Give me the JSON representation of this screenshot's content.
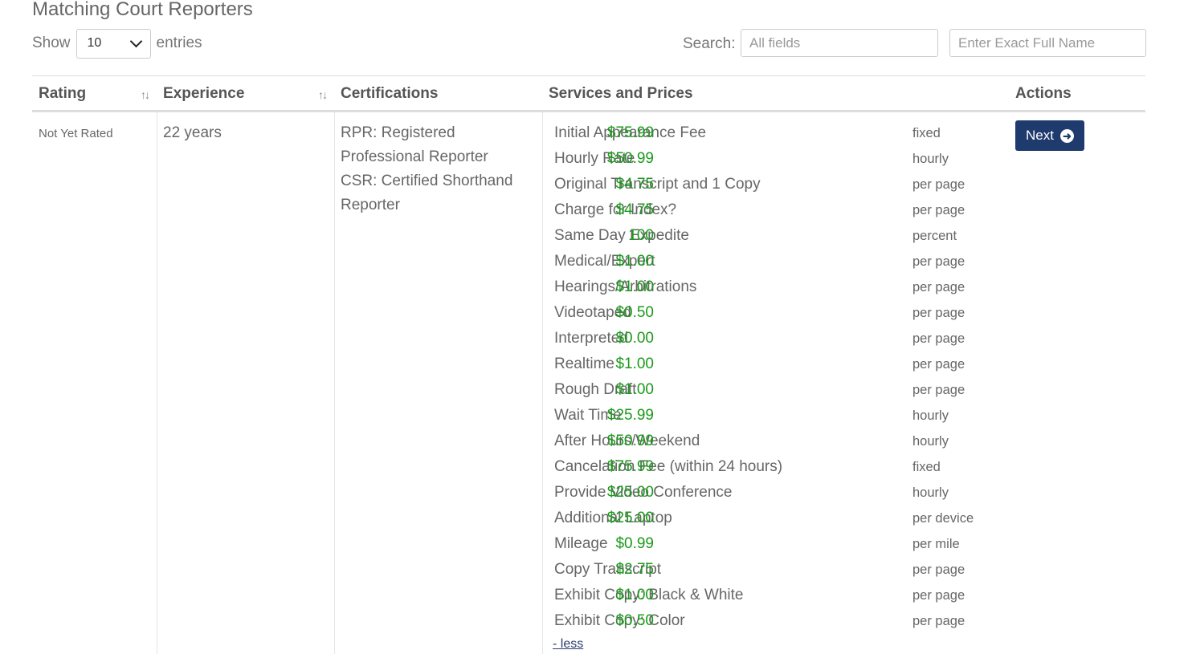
{
  "page": {
    "title": "Matching Court Reporters"
  },
  "length": {
    "show_label": "Show",
    "value": "10",
    "entries_label": "entries"
  },
  "search": {
    "label": "Search:",
    "all_fields_placeholder": "All fields",
    "exact_name_placeholder": "Enter Exact Full Name"
  },
  "table": {
    "headers": {
      "rating": "Rating",
      "experience": "Experience",
      "certifications": "Certifications",
      "services": "Services and Prices",
      "actions": "Actions"
    },
    "row": {
      "rating": "Not Yet Rated",
      "experience": "22 years",
      "certifications": [
        "RPR: Registered Professional Reporter",
        "CSR: Certified Shorthand Reporter"
      ],
      "services": [
        {
          "name": "Initial Appearance Fee",
          "price": "$75.99",
          "unit": "fixed"
        },
        {
          "name": "Hourly Rate",
          "price": "$50.99",
          "unit": "hourly"
        },
        {
          "name": "Original Transcript and 1 Copy",
          "price": "$4.75",
          "unit": "per page"
        },
        {
          "name": "Charge for Index?",
          "price": "$4.75",
          "unit": "per page"
        },
        {
          "name": "Same Day Expedite",
          "price": "100",
          "unit": "percent"
        },
        {
          "name": "Medical/Expert",
          "price": "$1.00",
          "unit": "per page"
        },
        {
          "name": "Hearings/Arbitrations",
          "price": "$1.00",
          "unit": "per page"
        },
        {
          "name": "Videotaped",
          "price": "$0.50",
          "unit": "per page"
        },
        {
          "name": "Interpreted",
          "price": "$0.00",
          "unit": "per page"
        },
        {
          "name": "Realtime",
          "price": "$1.00",
          "unit": "per page"
        },
        {
          "name": "Rough Draft",
          "price": "$1.00",
          "unit": "per page"
        },
        {
          "name": "Wait Time",
          "price": "$25.99",
          "unit": "hourly"
        },
        {
          "name": "After Hours/Weekend",
          "price": "$50.99",
          "unit": "hourly"
        },
        {
          "name": "Cancelation Fee (within 24 hours)",
          "price": "$75.99",
          "unit": "fixed"
        },
        {
          "name": "Provide Video Conference",
          "price": "$25.00",
          "unit": "hourly"
        },
        {
          "name": "Additional Laptop",
          "price": "$25.00",
          "unit": "per device"
        },
        {
          "name": "Mileage",
          "price": "$0.99",
          "unit": "per mile"
        },
        {
          "name": "Copy Transcript",
          "price": "$2.75",
          "unit": "per page"
        },
        {
          "name": "Exhibit Copy: Black & White",
          "price": "$1.00",
          "unit": "per page"
        },
        {
          "name": "Exhibit Copy: Color",
          "price": "$0.50",
          "unit": "per page"
        }
      ],
      "less_label": "- less",
      "action_label": "Next"
    }
  },
  "colors": {
    "price": "#1a9a1a",
    "button": "#1f3a6d"
  }
}
